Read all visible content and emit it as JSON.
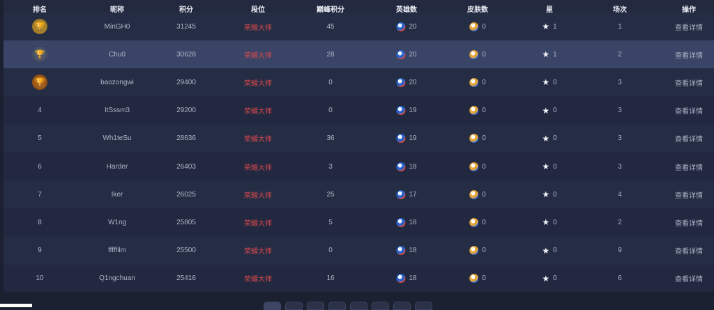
{
  "headers": [
    "排名",
    "昵称",
    "积分",
    "段位",
    "巅峰积分",
    "英雄数",
    "皮肤数",
    "星",
    "场次",
    "操作"
  ],
  "rows": [
    {
      "rank": "",
      "trophy": "gold",
      "name": "MinGH0",
      "score": "31245",
      "tier": "荣耀大师",
      "stat": "45",
      "hero": "20",
      "skin": "0",
      "star": "1",
      "count": "1",
      "action": "查看详情"
    },
    {
      "rank": "",
      "trophy": "silver",
      "name": "Chu0",
      "score": "30628",
      "tier": "荣耀大师",
      "stat": "28",
      "hero": "20",
      "skin": "0",
      "star": "1",
      "count": "2",
      "action": "查看详情"
    },
    {
      "rank": "",
      "trophy": "bronze",
      "name": "baozongwi",
      "score": "29400",
      "tier": "荣耀大师",
      "stat": "0",
      "hero": "20",
      "skin": "0",
      "star": "0",
      "count": "3",
      "action": "查看详情"
    },
    {
      "rank": "4",
      "trophy": "",
      "name": "ItSssm3",
      "score": "29200",
      "tier": "荣耀大师",
      "stat": "0",
      "hero": "19",
      "skin": "0",
      "star": "0",
      "count": "3",
      "action": "查看详情"
    },
    {
      "rank": "5",
      "trophy": "",
      "name": "Wh1teSu",
      "score": "28636",
      "tier": "荣耀大师",
      "stat": "36",
      "hero": "19",
      "skin": "0",
      "star": "0",
      "count": "3",
      "action": "查看详情"
    },
    {
      "rank": "6",
      "trophy": "",
      "name": "Harder",
      "score": "26403",
      "tier": "荣耀大师",
      "stat": "3",
      "hero": "18",
      "skin": "0",
      "star": "0",
      "count": "3",
      "action": "查看详情"
    },
    {
      "rank": "7",
      "trophy": "",
      "name": "Iker",
      "score": "26025",
      "tier": "荣耀大师",
      "stat": "25",
      "hero": "17",
      "skin": "0",
      "star": "0",
      "count": "4",
      "action": "查看详情"
    },
    {
      "rank": "8",
      "trophy": "",
      "name": "W1ng",
      "score": "25805",
      "tier": "荣耀大师",
      "stat": "5",
      "hero": "18",
      "skin": "0",
      "star": "0",
      "count": "2",
      "action": "查看详情"
    },
    {
      "rank": "9",
      "trophy": "",
      "name": "fffffilm",
      "score": "25500",
      "tier": "荣耀大师",
      "stat": "0",
      "hero": "18",
      "skin": "0",
      "star": "0",
      "count": "9",
      "action": "查看详情"
    },
    {
      "rank": "10",
      "trophy": "",
      "name": "Q1ngchuan",
      "score": "25416",
      "tier": "荣耀大师",
      "stat": "16",
      "hero": "18",
      "skin": "0",
      "star": "0",
      "count": "6",
      "action": "查看详情"
    }
  ],
  "icons": {
    "trophy": "trophy-icon",
    "hero": "hero-badge-icon",
    "skin": "skin-badge-icon",
    "star": "star-icon"
  },
  "colors": {
    "tier": "#d8484c",
    "selected_row": "#3a4466",
    "panel": "#232a40"
  }
}
